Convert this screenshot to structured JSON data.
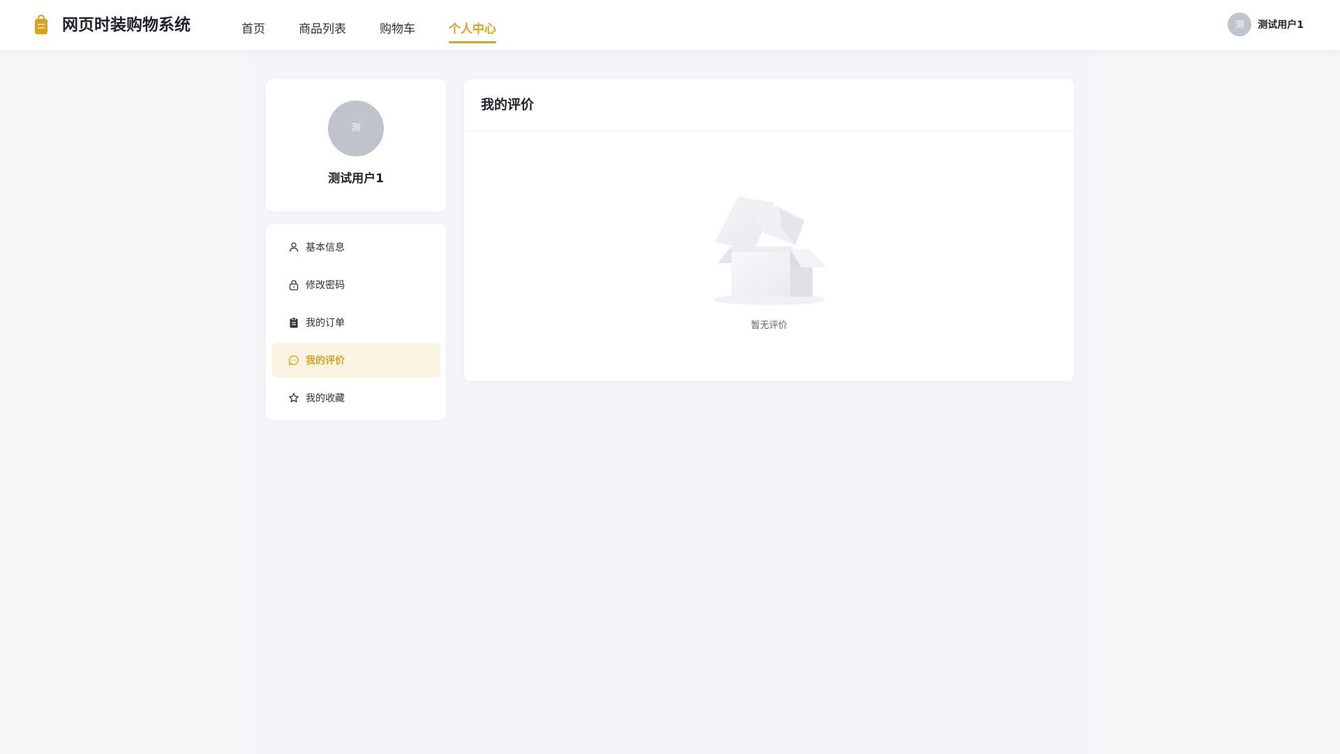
{
  "header": {
    "brand": "网页时装购物系统",
    "logo_icon": "shopping-bag-icon",
    "nav": [
      {
        "label": "首页",
        "active": false
      },
      {
        "label": "商品列表",
        "active": false
      },
      {
        "label": "购物车",
        "active": false
      },
      {
        "label": "个人中心",
        "active": true
      }
    ],
    "user": {
      "avatar_text": "测",
      "name": "测试用户1"
    }
  },
  "profile": {
    "avatar_text": "测",
    "name": "测试用户1"
  },
  "menu": {
    "items": [
      {
        "label": "基本信息",
        "icon": "user-icon",
        "active": false
      },
      {
        "label": "修改密码",
        "icon": "lock-icon",
        "active": false
      },
      {
        "label": "我的订单",
        "icon": "clipboard-icon",
        "active": false
      },
      {
        "label": "我的评价",
        "icon": "chat-bubble-icon",
        "active": true
      },
      {
        "label": "我的收藏",
        "icon": "star-icon",
        "active": false
      }
    ]
  },
  "reviews": {
    "title": "我的评价",
    "empty_text": "暂无评价",
    "empty_icon": "empty-box-icon"
  },
  "colors": {
    "accent": "#d4a422",
    "active_bg": "#fbf4e3",
    "page_bg": "#f5f6f8",
    "avatar_bg": "#c0c4cc"
  }
}
